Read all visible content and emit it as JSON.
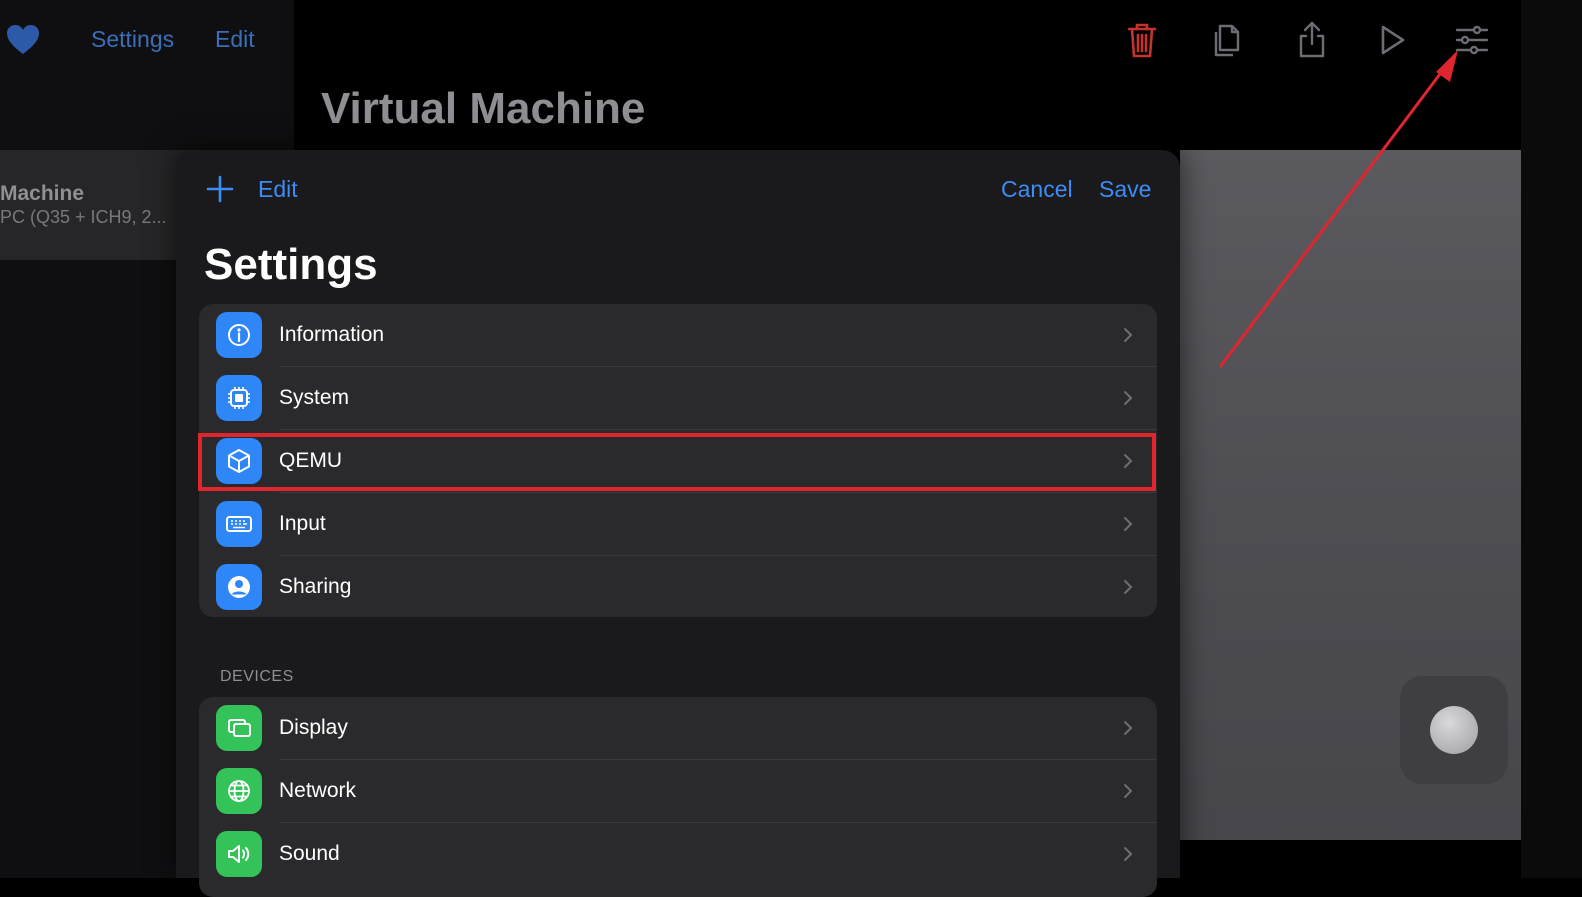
{
  "sidebar": {
    "favorite_icon": "heart-icon",
    "settings_label": "Settings",
    "edit_label": "Edit",
    "vm_item": {
      "title": "Machine",
      "subtitle": "PC (Q35 + ICH9, 2..."
    }
  },
  "header": {
    "title": "Virtual Machine",
    "toolbar_icons": [
      "trash-icon",
      "clone-icon",
      "share-icon",
      "play-icon",
      "settings-sliders-icon"
    ]
  },
  "sheet": {
    "add_icon": "plus-icon",
    "edit_label": "Edit",
    "cancel_label": "Cancel",
    "save_label": "Save",
    "title": "Settings",
    "general_items": [
      {
        "label": "Information",
        "icon": "info-icon"
      },
      {
        "label": "System",
        "icon": "cpu-icon"
      },
      {
        "label": "QEMU",
        "icon": "cube-icon"
      },
      {
        "label": "Input",
        "icon": "keyboard-icon"
      },
      {
        "label": "Sharing",
        "icon": "person-icon"
      }
    ],
    "devices_header": "DEVICES",
    "device_items": [
      {
        "label": "Display",
        "icon": "display-icon"
      },
      {
        "label": "Network",
        "icon": "globe-icon"
      },
      {
        "label": "Sound",
        "icon": "speaker-icon"
      }
    ]
  },
  "colors": {
    "accent": "#3d8cf5",
    "icon_blue": "#2f86f6",
    "icon_green": "#34c359",
    "annotation_red": "#e0262d",
    "delete_red": "#d23a36"
  }
}
